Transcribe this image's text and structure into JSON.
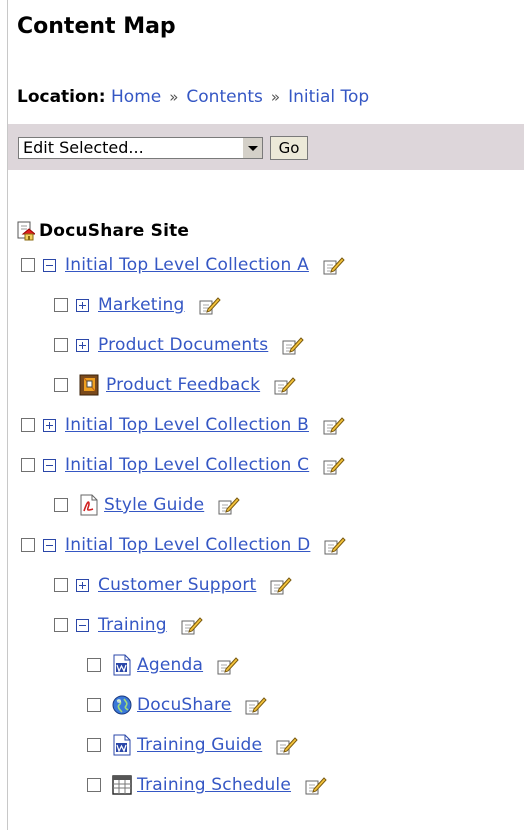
{
  "header": {
    "title": "Content Map"
  },
  "location": {
    "label": "Location:",
    "crumbs": [
      "Home",
      "Contents",
      "Initial Top"
    ],
    "separator": "»"
  },
  "toolbar": {
    "select_value": "Edit Selected...",
    "go_label": "Go"
  },
  "tree": {
    "root": "DocuShare Site",
    "items": [
      {
        "label": "Initial Top Level Collection A",
        "icon": "collapse-icon"
      },
      {
        "label": "Marketing",
        "icon": "expand-icon"
      },
      {
        "label": "Product Documents",
        "icon": "expand-icon"
      },
      {
        "label": "Product Feedback",
        "icon": "bulletin-board-icon"
      },
      {
        "label": "Initial Top Level Collection B",
        "icon": "expand-icon"
      },
      {
        "label": "Initial Top Level Collection C",
        "icon": "collapse-icon"
      },
      {
        "label": "Style Guide",
        "icon": "pdf-icon"
      },
      {
        "label": "Initial Top Level Collection D",
        "icon": "collapse-icon"
      },
      {
        "label": "Customer Support",
        "icon": "expand-icon"
      },
      {
        "label": "Training",
        "icon": "collapse-icon"
      },
      {
        "label": "Agenda",
        "icon": "word-doc-icon"
      },
      {
        "label": "DocuShare",
        "icon": "globe-icon"
      },
      {
        "label": "Training Guide",
        "icon": "word-doc-icon"
      },
      {
        "label": "Training Schedule",
        "icon": "calendar-icon"
      }
    ]
  },
  "colors": {
    "link": "#3557c4",
    "toolbar_bg": "#ddd6da",
    "expander": "#2b47a8"
  }
}
